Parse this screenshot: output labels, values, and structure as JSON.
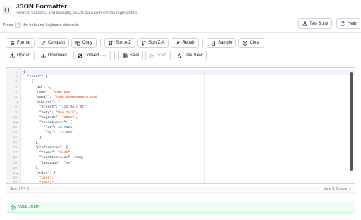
{
  "app": {
    "title": "JSON Formatter",
    "subtitle": "Format, validate, and beautify JSON data with syntax highlighting"
  },
  "hint": {
    "prefix": "Press",
    "key": "?",
    "suffix": "for help and keyboard shortcuts"
  },
  "header_buttons": {
    "test_suite": "Test Suite",
    "help": "Help"
  },
  "toolbar": {
    "row1": [
      "Format",
      "Compact",
      "Copy",
      "Sort A-Z",
      "Sort Z-A",
      "Repair",
      "Sample",
      "Clear"
    ],
    "row2": [
      "Upload",
      "Download",
      "Convert",
      "Save",
      "Load",
      "Tree View"
    ]
  },
  "editor": {
    "line_numbers": [
      "1",
      "2",
      "3",
      "4",
      "5",
      "6",
      "7",
      "8",
      "9",
      "10",
      "11",
      "12",
      "13",
      "14",
      "15",
      "16",
      "17",
      "18",
      "19",
      "20",
      "21",
      "22",
      "23",
      "24",
      "25"
    ],
    "lines": [
      "{",
      "  \"users\": [",
      "    {",
      "      \"id\": 1,",
      "      \"name\": \"John Doe\",",
      "      \"email\": \"john.doe@example.com\",",
      "      \"address\": {",
      "        \"street\": \"123 Main St\",",
      "        \"city\": \"New York\",",
      "        \"zipCode\": \"10001\",",
      "        \"coordinates\": {",
      "          \"lat\": 40.7128,",
      "          \"lng\": -74.006",
      "        }",
      "      },",
      "      \"preferences\": {",
      "        \"theme\": \"dark\",",
      "        \"notifications\": true,",
      "        \"language\": \"en\"",
      "      },",
      "      \"roles\": [",
      "        \"user\",",
      "        \"admin\"",
      "      ]"
    ]
  },
  "status": {
    "size": "Size: 17.4 B",
    "position": "Line 1, Column 1"
  },
  "validation": {
    "message": "Valid JSON"
  },
  "colors": {
    "valid": "#15803d",
    "string": "#c2410c",
    "number": "#0f766e"
  }
}
